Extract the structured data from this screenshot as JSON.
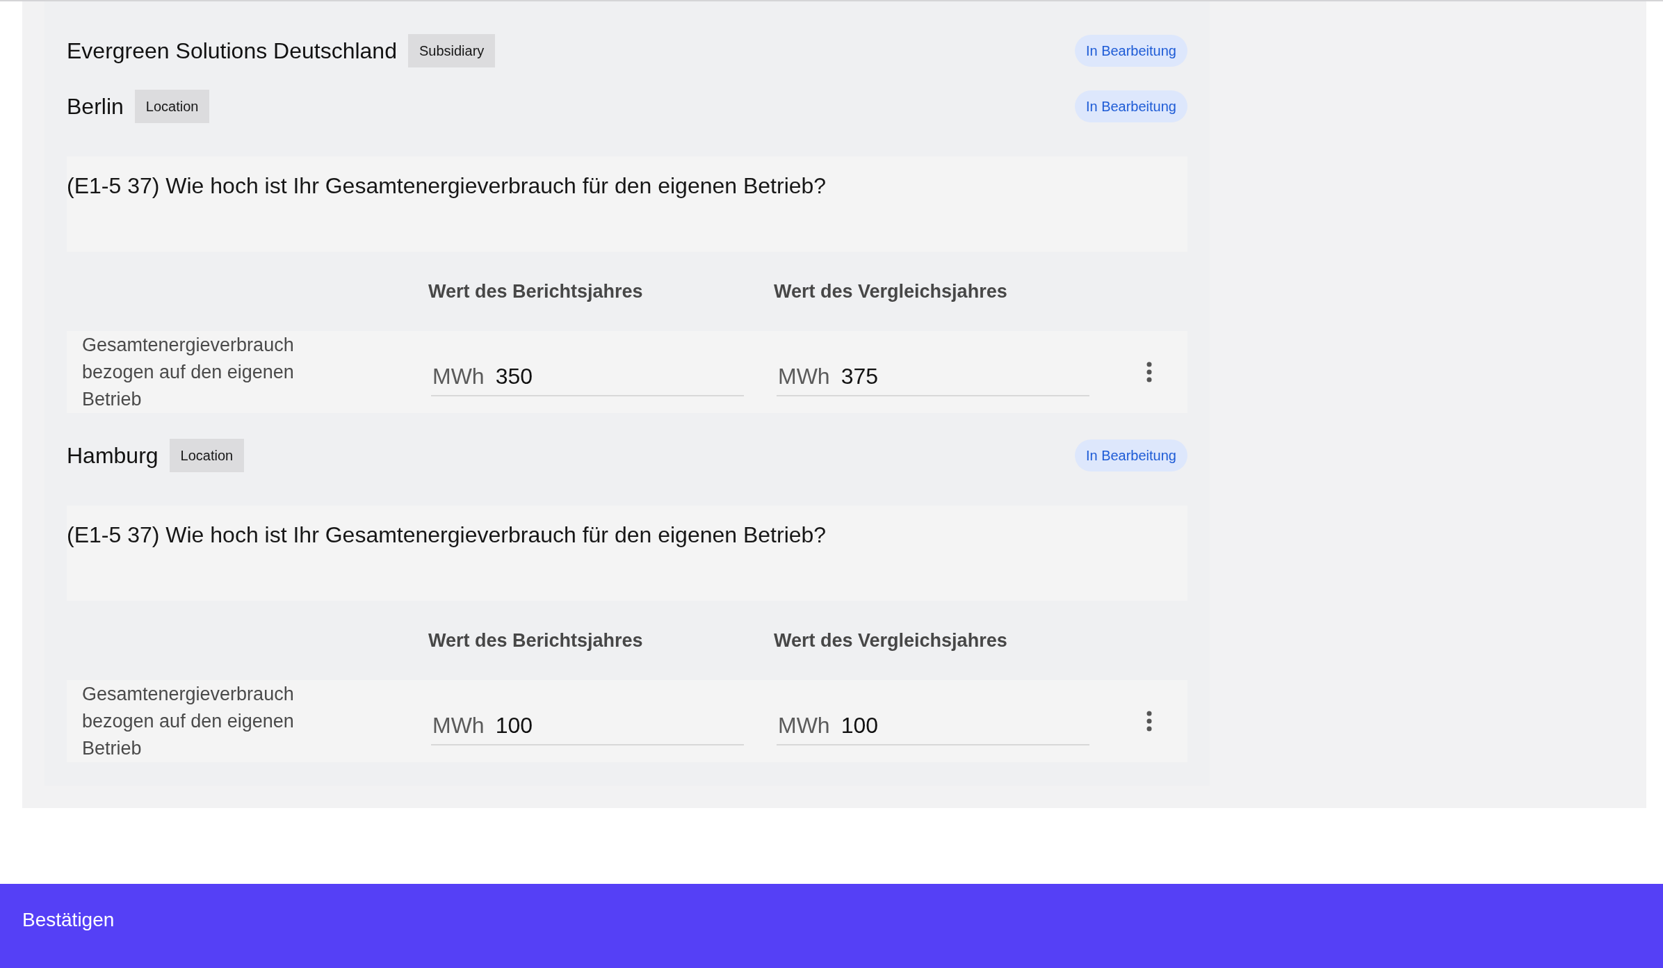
{
  "header": {
    "name": "Evergreen Solutions Deutschland",
    "tag": "Subsidiary",
    "status": "In Bearbeitung"
  },
  "locations": [
    {
      "name": "Berlin",
      "tag": "Location",
      "status": "In Bearbeitung",
      "question": "(E1-5 37) Wie hoch ist Ihr Gesamtenergieverbrauch für den eigenen Betrieb?",
      "columns": [
        "Wert des Berichtsjahres",
        "Wert des Vergleichsjahres"
      ],
      "rows": [
        {
          "label": "Gesamtenergieverbrauch bezogen auf den eigenen Betrieb",
          "fields": [
            {
              "unit": "MWh",
              "value": "350"
            },
            {
              "unit": "MWh",
              "value": "375"
            }
          ]
        }
      ]
    },
    {
      "name": "Hamburg",
      "tag": "Location",
      "status": "In Bearbeitung",
      "question": "(E1-5 37) Wie hoch ist Ihr Gesamtenergieverbrauch für den eigenen Betrieb?",
      "columns": [
        "Wert des Berichtsjahres",
        "Wert des Vergleichsjahres"
      ],
      "rows": [
        {
          "label": "Gesamtenergieverbrauch bezogen auf den eigenen Betrieb",
          "fields": [
            {
              "unit": "MWh",
              "value": "100"
            },
            {
              "unit": "MWh",
              "value": "100"
            }
          ]
        }
      ]
    }
  ],
  "confirm_button": "Bestätigen"
}
